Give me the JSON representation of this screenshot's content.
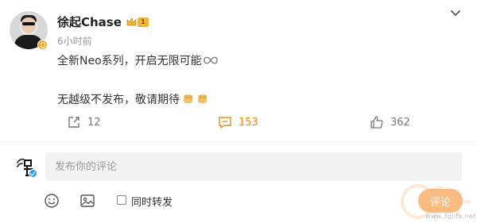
{
  "post": {
    "username": "徐起Chase",
    "vip_level": "1",
    "time": "6小时前",
    "text_line1": "全新Neo系列，开启无限可能",
    "text_line2": "无越级不发布，敬请期待",
    "icons": {
      "more": "chevron-down-icon",
      "infinity": "infinity-emoji",
      "fist": "raised-fist-emoji"
    }
  },
  "actions": {
    "share_count": "12",
    "comment_count": "153",
    "like_count": "362",
    "comment_color": "#f08b1b"
  },
  "composer": {
    "placeholder": "发布你的评论",
    "repost_label": "同时转发",
    "submit_label": "评论",
    "repost_checked": false
  },
  "watermark": {
    "url": "www.3glife.net"
  },
  "colors": {
    "accent": "#f08b1b",
    "submit_bg": "#f9bb82",
    "vip_gold": "#f2b531",
    "verified_blue": "#2f9ff0"
  }
}
